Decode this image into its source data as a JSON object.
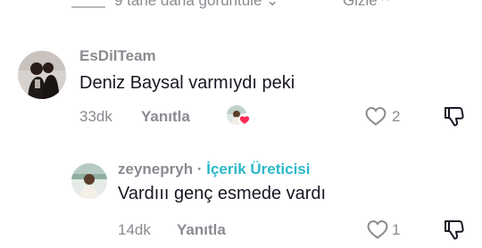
{
  "replies_bar": {
    "more_label": "9 tane daha görüntüle",
    "hide_label": "Gizle"
  },
  "comments": [
    {
      "username": "EsDilTeam",
      "text": "Deniz Baysal varmıydı peki",
      "time": "33dk",
      "reply_label": "Yanıtla",
      "likes": "2"
    },
    {
      "username": "zeynepryh",
      "separator": "·",
      "badge": "İçerik Üreticisi",
      "text": "Vardııı genç esmede vardı",
      "time": "14dk",
      "reply_label": "Yanıtla",
      "likes": "1"
    }
  ],
  "colors": {
    "secondary_text": "#8a8b91",
    "creator_badge": "#2bb8c8",
    "like_heart": "#fe2c55"
  }
}
